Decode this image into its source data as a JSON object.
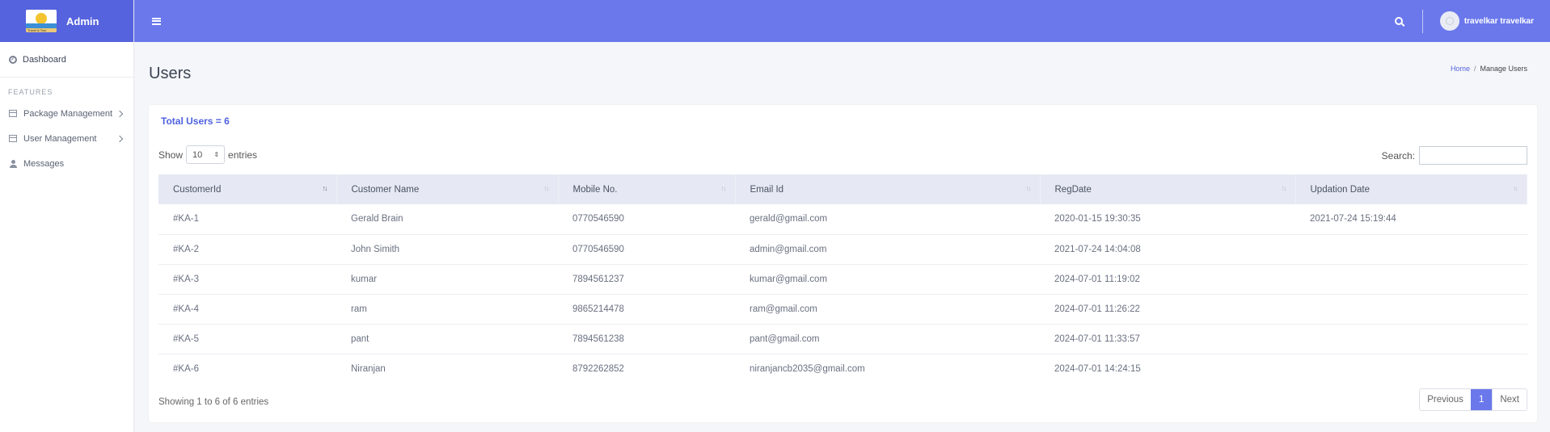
{
  "brand": {
    "name": "Admin",
    "logo_text": "Travel & Tour"
  },
  "sidebar": {
    "dashboard": "Dashboard",
    "section_title": "FEATURES",
    "items": [
      {
        "label": "Package Management",
        "has_chevron": true
      },
      {
        "label": "User Management",
        "has_chevron": true
      },
      {
        "label": "Messages",
        "has_chevron": false
      }
    ]
  },
  "topbar": {
    "username": "travelkar travelkar"
  },
  "page": {
    "title": "Users",
    "breadcrumb": {
      "home": "Home",
      "separator": "/",
      "current": "Manage Users"
    }
  },
  "card": {
    "total_users": "Total Users = 6",
    "show_label": "Show",
    "page_length": "10",
    "entries_label": "entries",
    "search_label": "Search:",
    "search_value": ""
  },
  "table": {
    "headers": [
      "CustomerId",
      "Customer Name",
      "Mobile No.",
      "Email Id",
      "RegDate",
      "Updation Date"
    ],
    "rows": [
      [
        "#KA-1",
        "Gerald Brain",
        "0770546590",
        "gerald@gmail.com",
        "2020-01-15 19:30:35",
        "2021-07-24 15:19:44"
      ],
      [
        "#KA-2",
        "John Simith",
        "0770546590",
        "admin@gmail.com",
        "2021-07-24 14:04:08",
        ""
      ],
      [
        "#KA-3",
        "kumar",
        "7894561237",
        "kumar@gmail.com",
        "2024-07-01 11:19:02",
        ""
      ],
      [
        "#KA-4",
        "ram",
        "9865214478",
        "ram@gmail.com",
        "2024-07-01 11:26:22",
        ""
      ],
      [
        "#KA-5",
        "pant",
        "7894561238",
        "pant@gmail.com",
        "2024-07-01 11:33:57",
        ""
      ],
      [
        "#KA-6",
        "Niranjan",
        "8792262852",
        "niranjancb2035@gmail.com",
        "2024-07-01 14:24:15",
        ""
      ]
    ]
  },
  "footer": {
    "info": "Showing 1 to 6 of 6 entries",
    "previous": "Previous",
    "current_page": "1",
    "next": "Next"
  },
  "colors": {
    "accent": "#6a78ec",
    "brand_bg": "#5563de",
    "link": "#4f61e0"
  },
  "icons": {
    "menu": "hamburger-icon",
    "search": "search-icon",
    "dashboard": "dashboard-icon",
    "package": "table-icon",
    "user_mgmt": "table-icon",
    "messages": "user-icon",
    "sort": "sort-arrows-icon"
  }
}
